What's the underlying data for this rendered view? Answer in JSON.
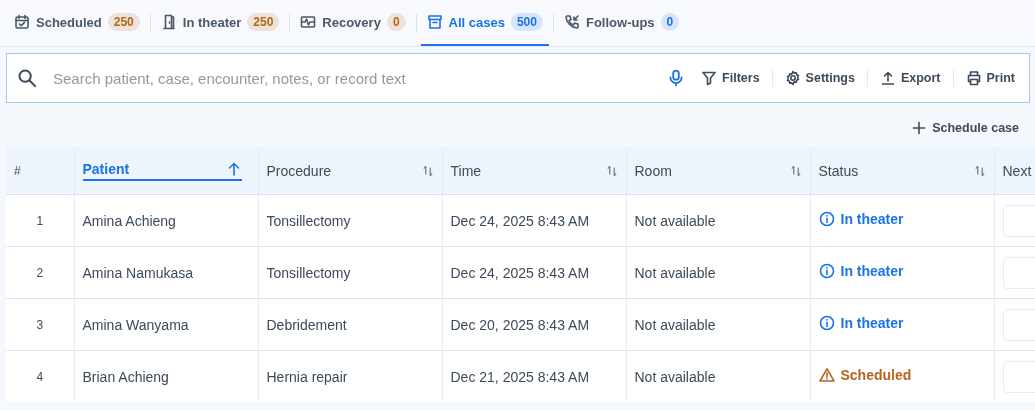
{
  "tabs": [
    {
      "label": "Scheduled",
      "count": "250",
      "color": "#b5651d",
      "selected": false
    },
    {
      "label": "In theater",
      "count": "250",
      "color": "#b5651d",
      "selected": false
    },
    {
      "label": "Recovery",
      "count": "0",
      "color": "#b5651d",
      "selected": false
    },
    {
      "label": "All cases",
      "count": "500",
      "color": "#1a73e8",
      "selected": true
    },
    {
      "label": "Follow-ups",
      "count": "0",
      "color": "#1a73e8",
      "selected": false
    }
  ],
  "search": {
    "placeholder": "Search patient, case, encounter, notes, or record text"
  },
  "search_actions": [
    {
      "label": "Filters"
    },
    {
      "label": "Settings"
    },
    {
      "label": "Export"
    },
    {
      "label": "Print"
    }
  ],
  "schedule_button": "Schedule case",
  "table": {
    "columns": [
      {
        "label": "#",
        "sortable": false
      },
      {
        "label": "Patient",
        "sortable": true,
        "sorted": true
      },
      {
        "label": "Procedure",
        "sortable": true,
        "sorted": false
      },
      {
        "label": "Time",
        "sortable": true,
        "sorted": false
      },
      {
        "label": "Room",
        "sortable": true,
        "sorted": false
      },
      {
        "label": "Status",
        "sortable": true,
        "sorted": false
      },
      {
        "label": "Next"
      }
    ],
    "rows": [
      {
        "index": "1",
        "patient": "Amina Achieng",
        "procedure": "Tonsillectomy",
        "time": "Dec 24, 2025 8:43 AM",
        "room": "Not available",
        "status": "In theater",
        "kind": "info"
      },
      {
        "index": "2",
        "patient": "Amina Namukasa",
        "procedure": "Tonsillectomy",
        "time": "Dec 24, 2025 8:43 AM",
        "room": "Not available",
        "status": "In theater",
        "kind": "info"
      },
      {
        "index": "3",
        "patient": "Amina Wanyama",
        "procedure": "Debridement",
        "time": "Dec 20, 2025 8:43 AM",
        "room": "Not available",
        "status": "In theater",
        "kind": "info"
      },
      {
        "index": "4",
        "patient": "Brian Achieng",
        "procedure": "Hernia repair",
        "time": "Dec 21, 2025 8:43 AM",
        "room": "Not available",
        "status": "Scheduled",
        "kind": "warning"
      }
    ]
  }
}
